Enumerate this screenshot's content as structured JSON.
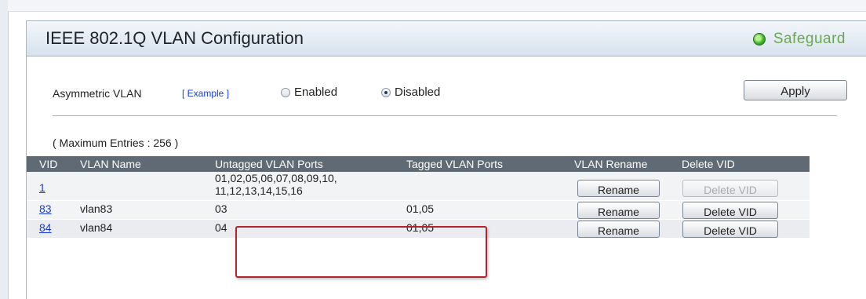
{
  "header": {
    "title": "IEEE 802.1Q VLAN Configuration",
    "safeguard_label": "Safeguard"
  },
  "asymmetric": {
    "label": "Asymmetric VLAN",
    "example_link": "[ Example ]",
    "options": {
      "enabled": "Enabled",
      "disabled": "Disabled"
    },
    "selected": "Disabled"
  },
  "apply_label": "Apply",
  "max_entries": "( Maximum Entries : 256 )",
  "table": {
    "headers": [
      "VID",
      "VLAN Name",
      "Untagged VLAN Ports",
      "Tagged VLAN Ports",
      "VLAN Rename",
      "Delete VID"
    ],
    "rows": [
      {
        "vid": "1",
        "name": "",
        "untagged_line1": "01,02,05,06,07,08,09,10,",
        "untagged_line2": "11,12,13,14,15,16",
        "tagged": "",
        "rename_label": "Rename",
        "delete_label": "Delete VID",
        "delete_enabled": false
      },
      {
        "vid": "83",
        "name": "vlan83",
        "untagged": "03",
        "tagged": "01,05",
        "rename_label": "Rename",
        "delete_label": "Delete VID",
        "delete_enabled": true
      },
      {
        "vid": "84",
        "name": "vlan84",
        "untagged": "04",
        "tagged": "01,05",
        "rename_label": "Rename",
        "delete_label": "Delete VID",
        "delete_enabled": true
      }
    ]
  },
  "colors": {
    "header_row_bg": "#606a74",
    "link": "#1a3dd6",
    "safeguard_green": "#6aa84f",
    "highlight_red": "#b3242c"
  }
}
